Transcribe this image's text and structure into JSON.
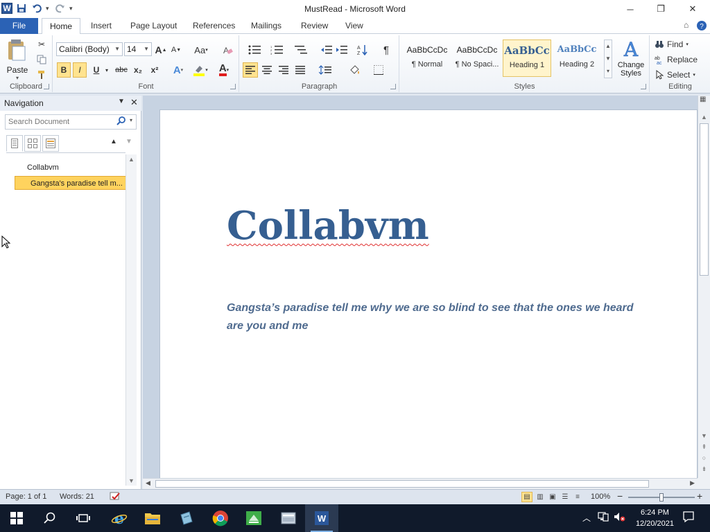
{
  "window": {
    "title": "MustRead  -  Microsoft Word",
    "minimize": "─",
    "maximize": "❐",
    "close": "✕"
  },
  "qat": {
    "logo": "W",
    "save": "save-icon",
    "undo": "undo-icon",
    "redo": "redo-icon"
  },
  "tabs": [
    {
      "label": "File"
    },
    {
      "label": "Home"
    },
    {
      "label": "Insert"
    },
    {
      "label": "Page Layout"
    },
    {
      "label": "References"
    },
    {
      "label": "Mailings"
    },
    {
      "label": "Review"
    },
    {
      "label": "View"
    }
  ],
  "ribbon": {
    "clipboard": {
      "label": "Clipboard",
      "paste": "Paste"
    },
    "font": {
      "label": "Font",
      "family": "Calibri (Body)",
      "size": "14",
      "bold": "B",
      "italic": "I",
      "underline": "U",
      "strike": "abc",
      "subscript": "x₂",
      "superscript": "x²",
      "grow": "A",
      "shrink": "A",
      "change_case": "Aa",
      "color_letter": "A",
      "effects_letter": "A"
    },
    "paragraph": {
      "label": "Paragraph",
      "pilcrow": "¶"
    },
    "styles": {
      "label": "Styles",
      "items": [
        {
          "preview": "AaBbCcDc",
          "name": "¶ Normal"
        },
        {
          "preview": "AaBbCcDc",
          "name": "¶ No Spaci..."
        },
        {
          "preview": "AaBbCc",
          "name": "Heading 1"
        },
        {
          "preview": "AaBbCc",
          "name": "Heading 2"
        }
      ],
      "change_styles": "Change Styles"
    },
    "editing": {
      "label": "Editing",
      "find": "Find",
      "replace": "Replace",
      "select": "Select"
    }
  },
  "navigation": {
    "title": "Navigation",
    "search_placeholder": "Search Document",
    "headings": [
      {
        "text": "Collabvm",
        "level": 1,
        "selected": false
      },
      {
        "text": "Gangsta's paradise tell m...",
        "level": 2,
        "selected": true
      }
    ]
  },
  "document": {
    "title": "Collabvm",
    "body": "Gangsta’s paradise tell me why we are so blind to see that the ones we heard are you and me"
  },
  "status": {
    "page": "Page: 1 of 1",
    "words": "Words: 21",
    "zoom": "100%",
    "zoom_minus": "−",
    "zoom_plus": "+",
    "zoom_level": 0.5
  },
  "taskbar": {
    "time": "6:24 PM",
    "date": "12/20/2021"
  },
  "colors": {
    "title_blue": "#365f91",
    "file_tab": "#2b62b5",
    "highlight": "#ffd35e"
  }
}
